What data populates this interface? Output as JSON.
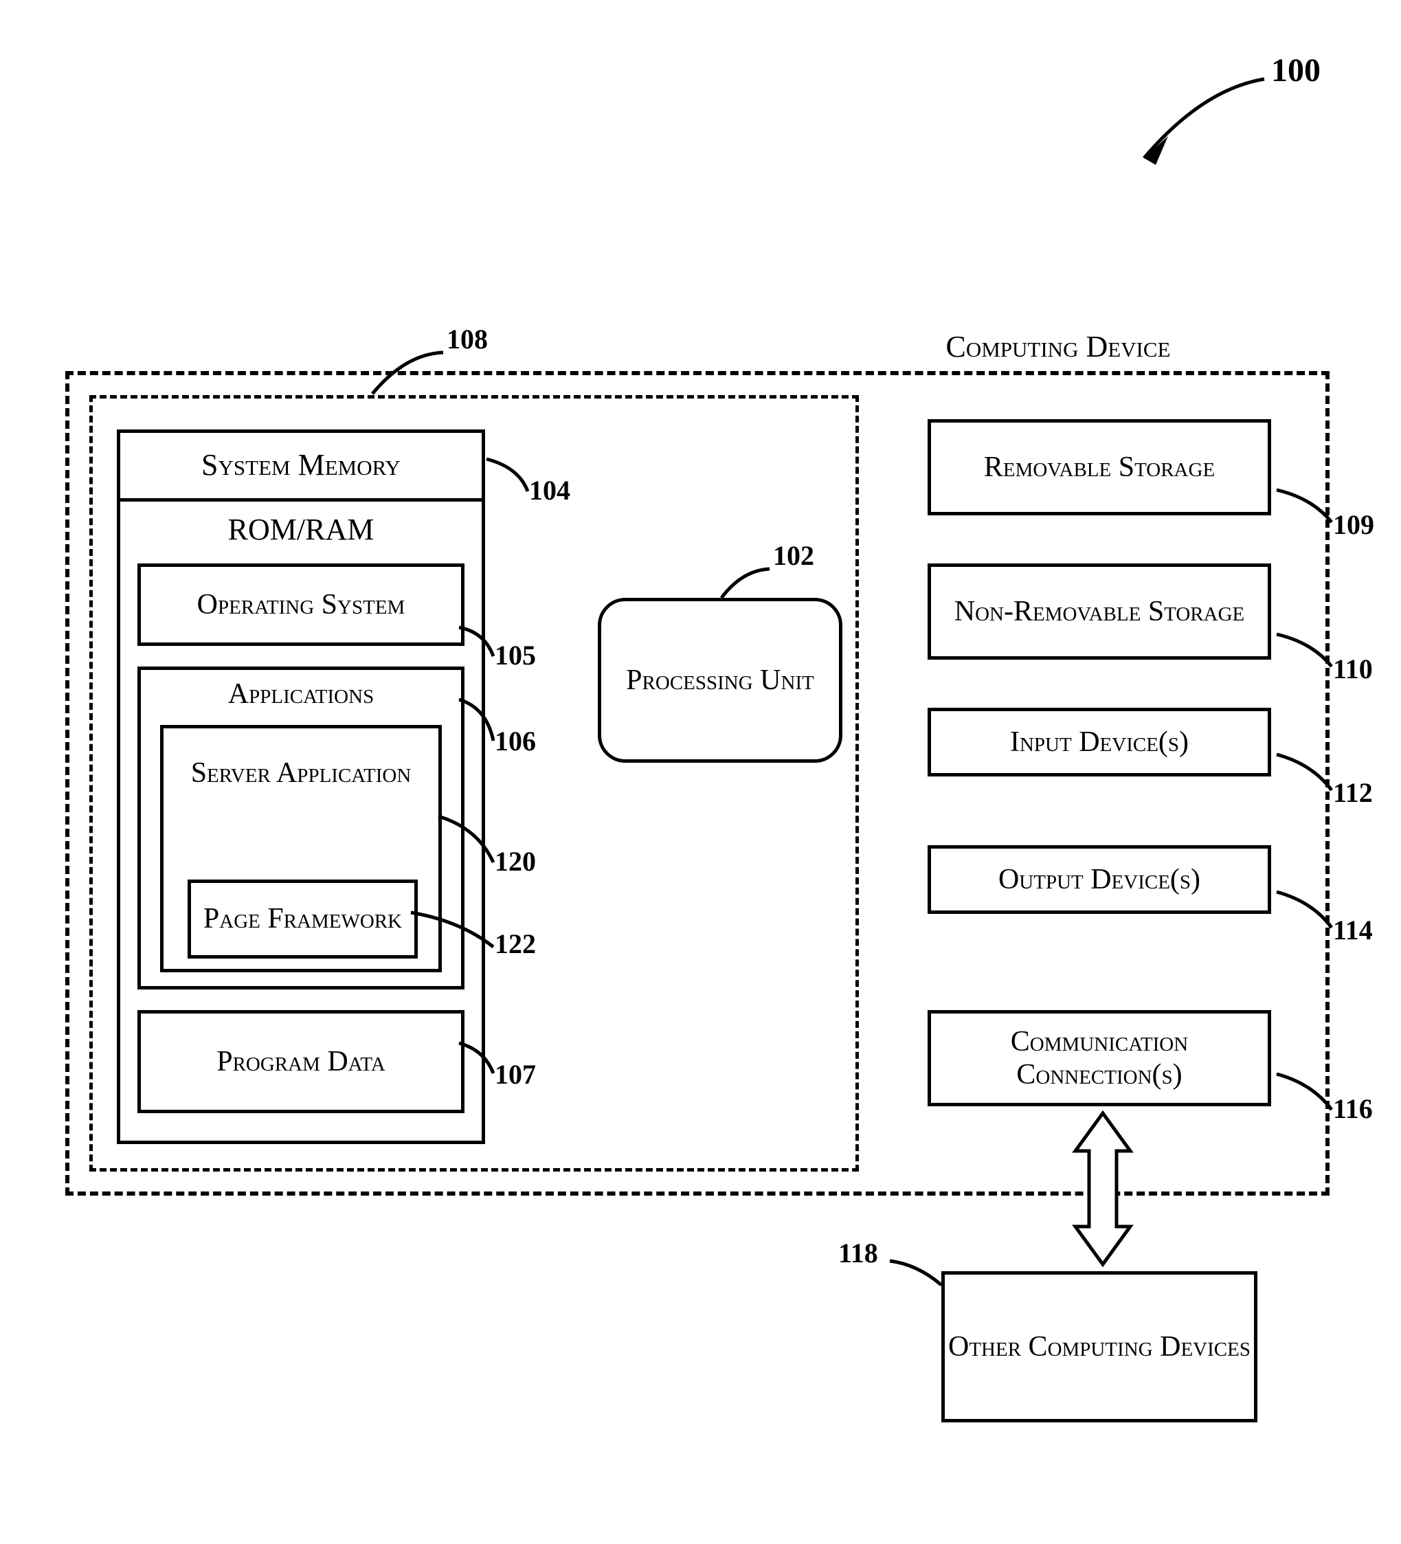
{
  "refs": {
    "r100": "100",
    "r108": "108",
    "r104": "104",
    "r102": "102",
    "r109": "109",
    "r105": "105",
    "r106": "106",
    "r120": "120",
    "r122": "122",
    "r107": "107",
    "r110": "110",
    "r112": "112",
    "r114": "114",
    "r116": "116",
    "r118": "118"
  },
  "labels": {
    "computing_device": "Computing Device",
    "system_memory": "System Memory",
    "rom_ram": "ROM/RAM",
    "operating_system": "Operating System",
    "applications": "Applications",
    "server_application": "Server Application",
    "page_framework": "Page Framework",
    "program_data": "Program Data",
    "processing_unit": "Processing Unit",
    "removable_storage": "Removable Storage",
    "non_removable_storage": "Non-Removable Storage",
    "input_devices": "Input Device(s)",
    "output_devices": "Output Device(s)",
    "communication_connections": "Communication Connection(s)",
    "other_computing_devices": "Other Computing Devices"
  }
}
